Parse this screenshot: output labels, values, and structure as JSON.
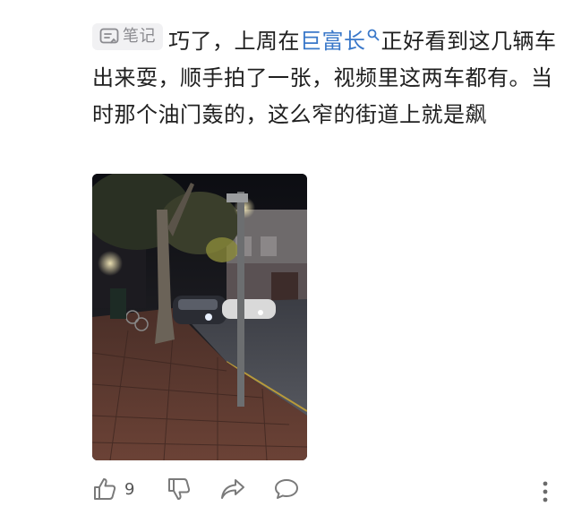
{
  "comment": {
    "tag_label": "笔记",
    "text_before": "巧了，上周在",
    "keyword": "巨富长",
    "text_after": "正好看到这几辆车出来耍，顺手拍了一张，视频里这两车都有。当时那个油门轰的，这么窄的街道上就是飙"
  },
  "actions": {
    "like_count": "9"
  },
  "icons": [
    "note-icon",
    "search-icon",
    "thumbs-up-icon",
    "thumbs-down-icon",
    "share-icon",
    "comment-icon",
    "more-icon"
  ],
  "colors": {
    "text": "#202020",
    "keyword": "#3a78c9",
    "tag_bg": "#f1f1f3",
    "icon_gray": "#7a7a7a"
  }
}
